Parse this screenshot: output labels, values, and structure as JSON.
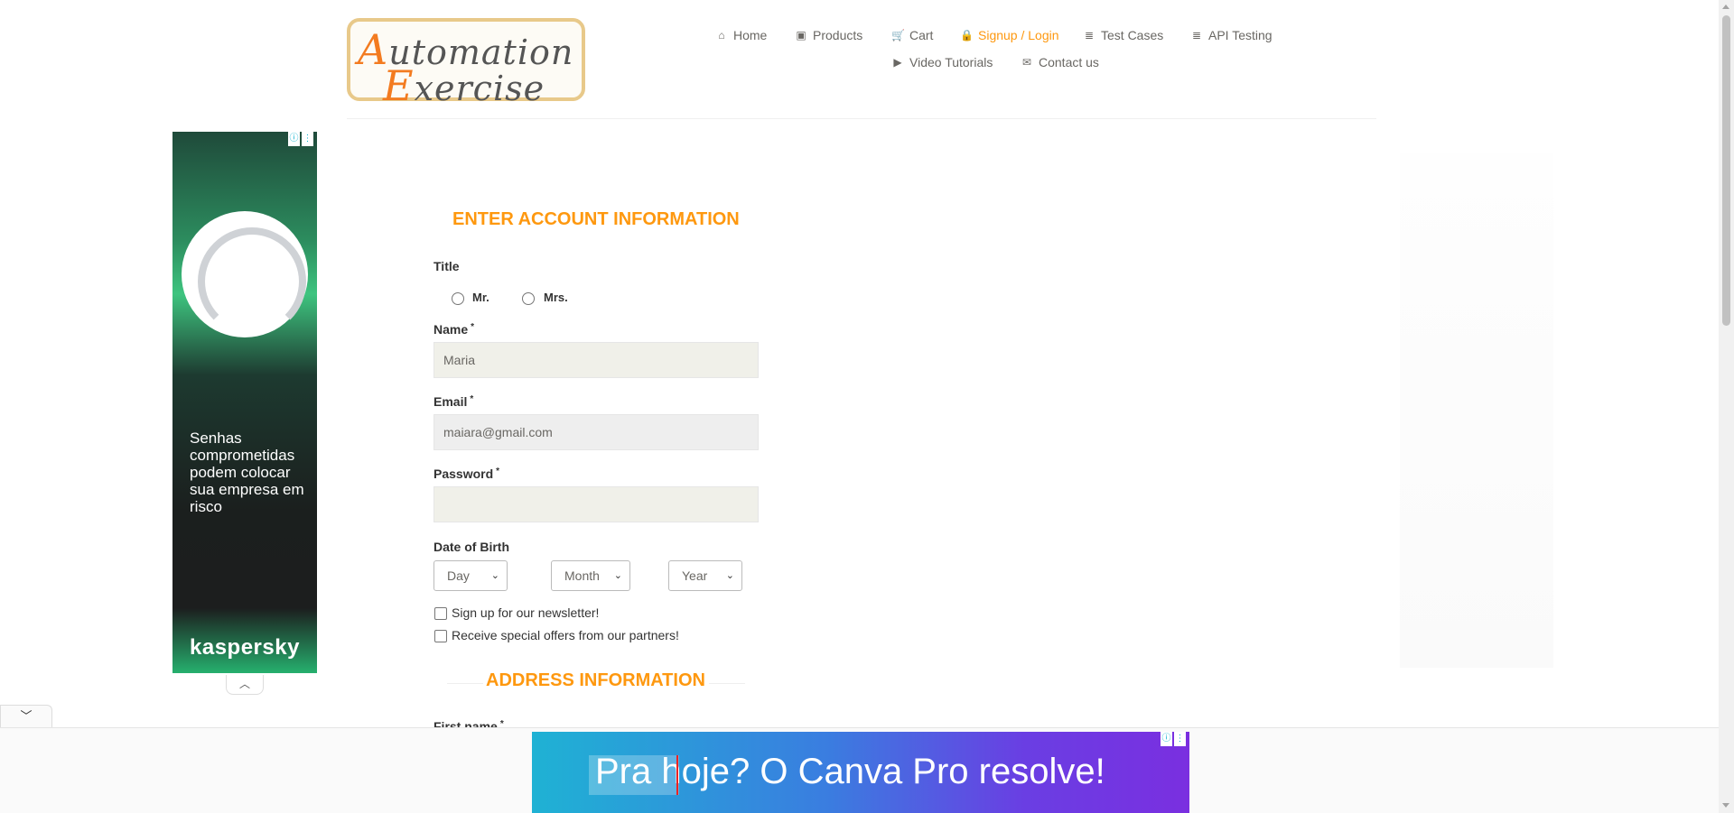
{
  "logo": {
    "line1_first": "A",
    "line1_rest": "utomation",
    "line2_first": "E",
    "line2_rest": "xercise"
  },
  "nav": {
    "items": [
      {
        "label": "Home",
        "icon": "home-icon",
        "glyph": "⌂"
      },
      {
        "label": "Products",
        "icon": "products-icon",
        "glyph": "▣"
      },
      {
        "label": "Cart",
        "icon": "cart-icon",
        "glyph": "🛒"
      },
      {
        "label": "Signup / Login",
        "icon": "lock-icon",
        "glyph": "🔒",
        "active": true
      },
      {
        "label": "Test Cases",
        "icon": "list-icon",
        "glyph": "≣"
      },
      {
        "label": "API Testing",
        "icon": "list-icon",
        "glyph": "≣"
      },
      {
        "label": "Video Tutorials",
        "icon": "youtube-icon",
        "glyph": "▶"
      },
      {
        "label": "Contact us",
        "icon": "envelope-icon",
        "glyph": "✉"
      }
    ]
  },
  "ads": {
    "left": {
      "text": "Senhas comprometidas podem colocar sua empresa em risco",
      "brand": "kaspersky"
    },
    "bottom": {
      "headline": "Pra hoje?  O Canva Pro resolve!"
    },
    "info_glyph": "ⓘ",
    "menu_glyph": "⋮",
    "collapse_glyph": "︿",
    "expand_glyph": "﹀"
  },
  "form": {
    "section_title": "ENTER ACCOUNT INFORMATION",
    "title_label": "Title",
    "title_options": [
      "Mr.",
      "Mrs."
    ],
    "name_label": "Name",
    "name_value": "Maria",
    "email_label": "Email",
    "email_value": "maiara@gmail.com",
    "password_label": "Password",
    "password_value": "",
    "required_mark": "*",
    "dob_label": "Date of Birth",
    "dob_day": "Day",
    "dob_month": "Month",
    "dob_year": "Year",
    "select_chevron": "⌄",
    "newsletter_label": "Sign up for our newsletter!",
    "offers_label": "Receive special offers from our partners!",
    "address_title": "ADDRESS INFORMATION",
    "first_name_label": "First name"
  },
  "colors": {
    "accent": "#fe980f",
    "text": "#333333",
    "nav_text": "#696763"
  }
}
